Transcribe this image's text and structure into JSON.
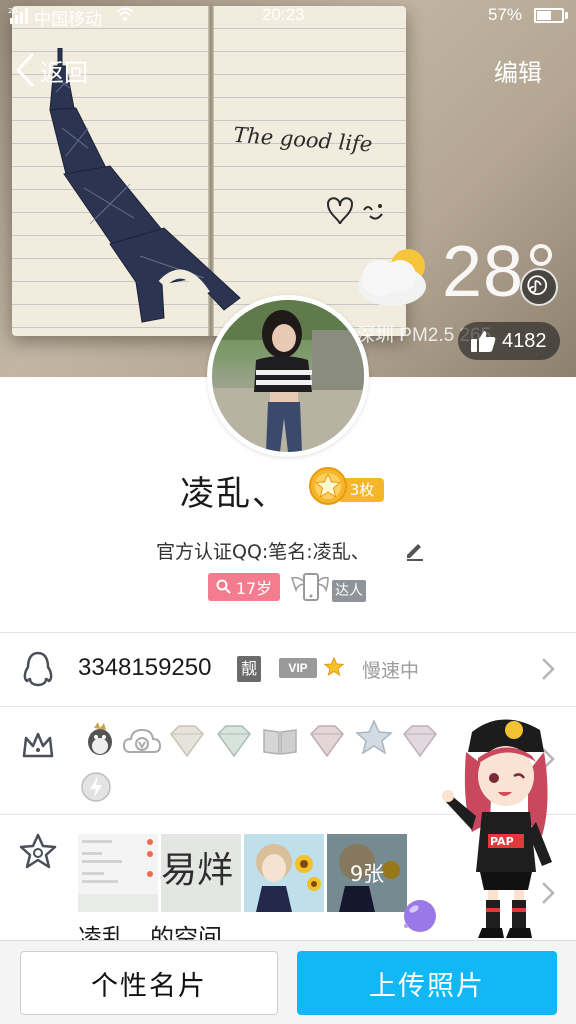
{
  "status_bar": {
    "carrier": "中国移动",
    "time": "20:23",
    "battery_percent": "57%",
    "battery_level": 0.57,
    "signal_icon": "signal-icon",
    "wifi_icon": "wifi-icon"
  },
  "nav": {
    "back_label": "返回",
    "edit_label": "编辑"
  },
  "cover": {
    "handwriting": "The good life",
    "weather_temp": "28",
    "weather_location": "深圳  PM2.5 265",
    "likes": "4182"
  },
  "profile": {
    "nickname": "凌乱、",
    "medal_count": "3枚",
    "signature": "官方认证QQ:笔名:凌乱、",
    "age": "17岁",
    "daren_label": "达人"
  },
  "qq_row": {
    "number": "3348159250",
    "liang_label": "靓",
    "vip_label": "VIP",
    "speed_status": "慢速中"
  },
  "privileges_row": {
    "icons": [
      "qq-penguin-icon",
      "weiyun-icon",
      "diamond-icon",
      "diamond-icon",
      "book-icon",
      "diamond-icon",
      "star-icon",
      "diamond-icon",
      "lightning-icon"
    ]
  },
  "space_row": {
    "photo_count": "9张",
    "label": "凌乱、的空间"
  },
  "buttons": {
    "card_label": "个性名片",
    "upload_label": "上传照片"
  },
  "colors": {
    "accent": "#12b7f5",
    "age_badge": "#f37c8f",
    "medal": "#f5b62c"
  }
}
